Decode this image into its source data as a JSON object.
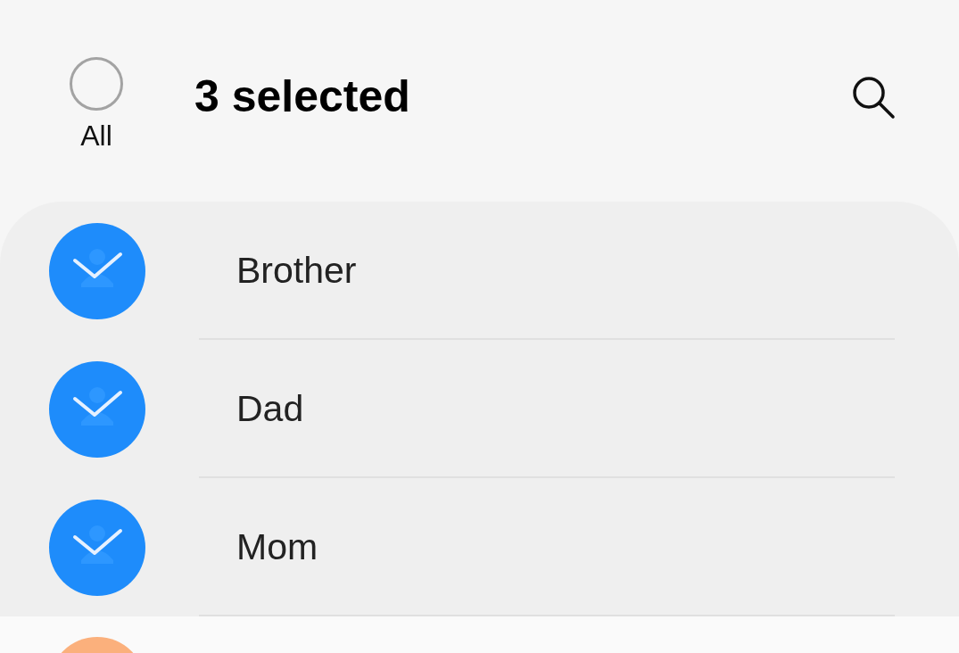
{
  "header": {
    "select_all": {
      "label": "All",
      "checked": false
    },
    "title": "3 selected"
  },
  "contacts": [
    {
      "name": "Brother",
      "selected": true
    },
    {
      "name": "Dad",
      "selected": true
    },
    {
      "name": "Mom",
      "selected": true
    },
    {
      "selected": false,
      "color": "#fbb07c"
    }
  ]
}
